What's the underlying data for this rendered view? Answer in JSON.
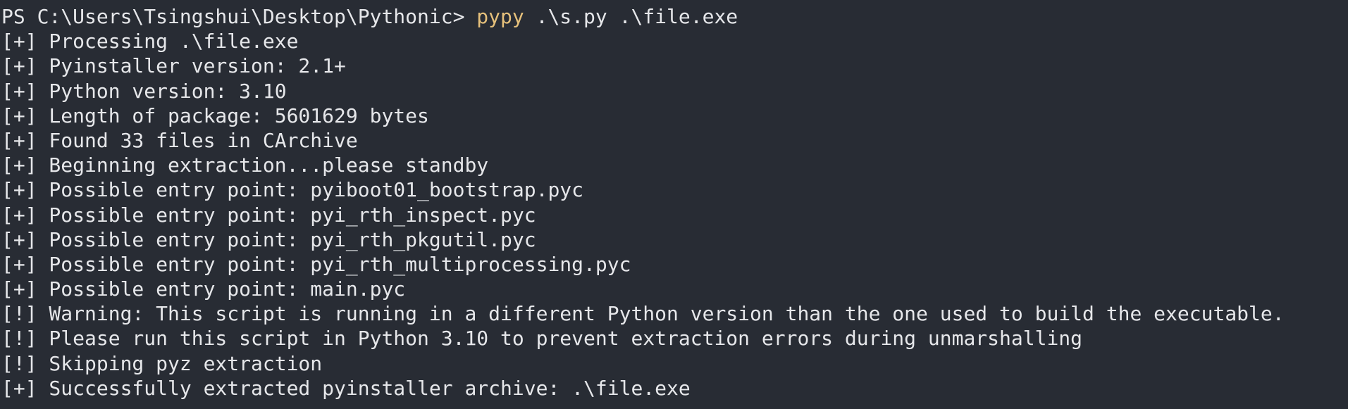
{
  "terminal": {
    "prompt": "PS C:\\Users\\Tsingshui\\Desktop\\Pythonic> ",
    "command": "pypy",
    "args": " .\\s.py .\\file.exe",
    "colors": {
      "background": "#282c34",
      "text": "#e6e7ea",
      "command": "#e5c07b"
    },
    "output": [
      "[+] Processing .\\file.exe",
      "[+] Pyinstaller version: 2.1+",
      "[+] Python version: 3.10",
      "[+] Length of package: 5601629 bytes",
      "[+] Found 33 files in CArchive",
      "[+] Beginning extraction...please standby",
      "[+] Possible entry point: pyiboot01_bootstrap.pyc",
      "[+] Possible entry point: pyi_rth_inspect.pyc",
      "[+] Possible entry point: pyi_rth_pkgutil.pyc",
      "[+] Possible entry point: pyi_rth_multiprocessing.pyc",
      "[+] Possible entry point: main.pyc",
      "[!] Warning: This script is running in a different Python version than the one used to build the executable.",
      "[!] Please run this script in Python 3.10 to prevent extraction errors during unmarshalling",
      "[!] Skipping pyz extraction",
      "[+] Successfully extracted pyinstaller archive: .\\file.exe"
    ]
  }
}
